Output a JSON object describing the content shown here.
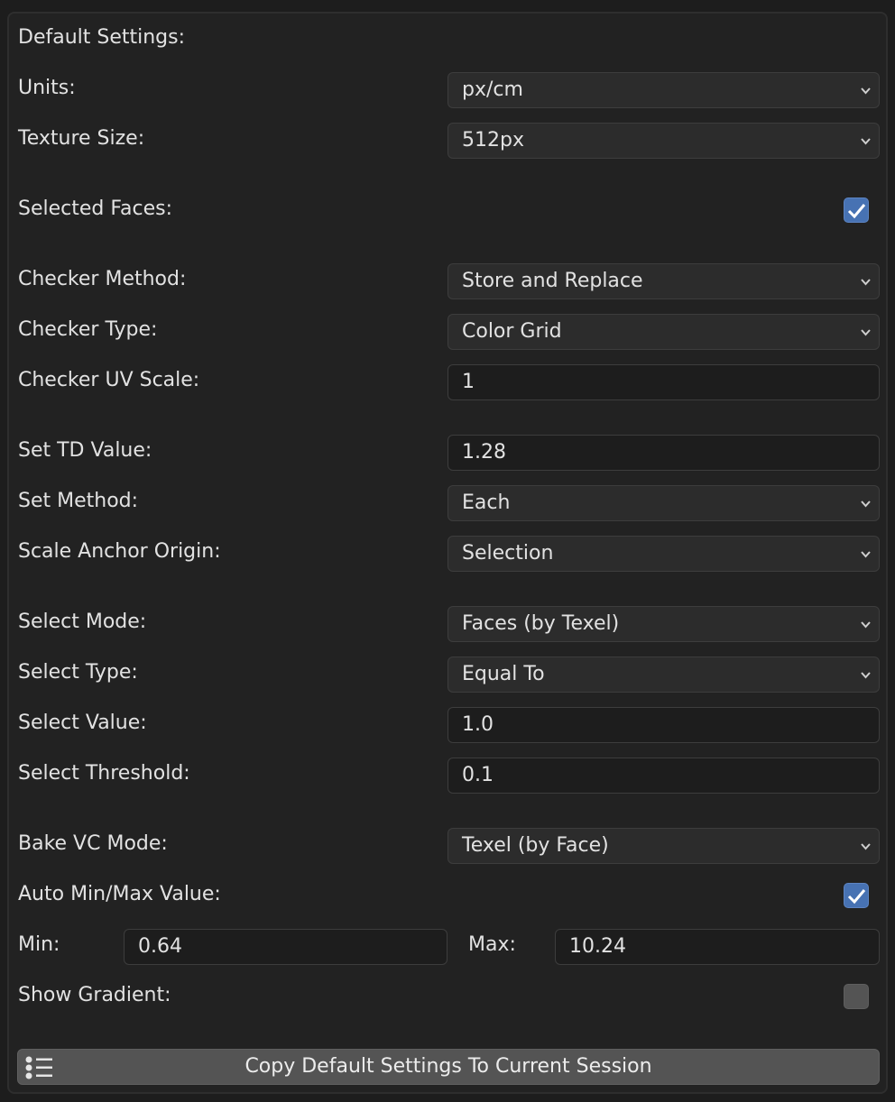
{
  "panel": {
    "header": "Default Settings:"
  },
  "rows": {
    "units": {
      "label": "Units:",
      "value": "px/cm"
    },
    "texture_size": {
      "label": "Texture Size:",
      "value": "512px"
    },
    "selected_faces": {
      "label": "Selected Faces:",
      "checked": true
    },
    "checker_method": {
      "label": "Checker Method:",
      "value": "Store and Replace"
    },
    "checker_type": {
      "label": "Checker Type:",
      "value": "Color Grid"
    },
    "checker_uv_scale": {
      "label": "Checker UV Scale:",
      "value": "1"
    },
    "set_td_value": {
      "label": "Set TD Value:",
      "value": "1.28"
    },
    "set_method": {
      "label": "Set Method:",
      "value": "Each"
    },
    "scale_anchor_origin": {
      "label": "Scale Anchor Origin:",
      "value": "Selection"
    },
    "select_mode": {
      "label": "Select Mode:",
      "value": "Faces (by Texel)"
    },
    "select_type": {
      "label": "Select Type:",
      "value": "Equal To"
    },
    "select_value": {
      "label": "Select Value:",
      "value": "1.0"
    },
    "select_threshold": {
      "label": "Select Threshold:",
      "value": "0.1"
    },
    "bake_vc_mode": {
      "label": "Bake VC Mode:",
      "value": "Texel (by Face)"
    },
    "auto_min_max": {
      "label": "Auto Min/Max Value:",
      "checked": true
    },
    "min": {
      "label": "Min:",
      "value": "0.64"
    },
    "max": {
      "label": "Max:",
      "value": "10.24"
    },
    "show_gradient": {
      "label": "Show Gradient:",
      "checked": false
    }
  },
  "copy_button": {
    "label": "Copy Default Settings To Current Session",
    "icon": "list-icon"
  },
  "icons": {
    "dropdown": "chevron-down-icon",
    "check": "checkmark-icon"
  },
  "colors": {
    "panel_bg": "#222222",
    "dropdown_bg": "#2c2c2c",
    "field_bg": "#1d1d1d",
    "checkbox_on": "#4772b3",
    "checkbox_off": "#545454",
    "button_bg": "#545454",
    "text": "#e2e2e2"
  }
}
